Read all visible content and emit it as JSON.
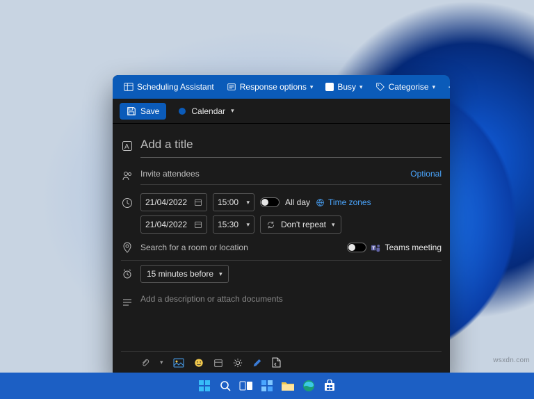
{
  "ribbon": {
    "scheduling": "Scheduling Assistant",
    "response": "Response options",
    "busy": "Busy",
    "categorise": "Categorise"
  },
  "savebar": {
    "save": "Save",
    "calendar": "Calendar"
  },
  "form": {
    "title_placeholder": "Add a title",
    "attendees_placeholder": "Invite attendees",
    "optional": "Optional",
    "start_date": "21/04/2022",
    "start_time": "15:00",
    "end_date": "21/04/2022",
    "end_time": "15:30",
    "all_day": "All day",
    "time_zones": "Time zones",
    "repeat": "Don't repeat",
    "location_placeholder": "Search for a room or location",
    "teams": "Teams meeting",
    "reminder": "15 minutes before",
    "description_placeholder": "Add a description or attach documents"
  },
  "watermark": "wsxdn.com"
}
